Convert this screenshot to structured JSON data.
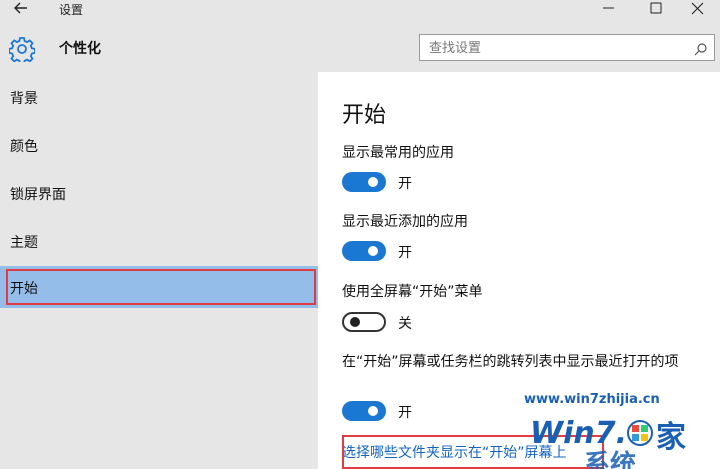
{
  "window": {
    "title": "设置"
  },
  "header": {
    "title": "个性化",
    "search_placeholder": "查找设置"
  },
  "sidebar": {
    "items": [
      {
        "label": "背景"
      },
      {
        "label": "颜色"
      },
      {
        "label": "锁屏界面"
      },
      {
        "label": "主题"
      },
      {
        "label": "开始",
        "active": true
      }
    ]
  },
  "main": {
    "section_title": "开始",
    "settings": [
      {
        "label": "显示最常用的应用",
        "state": "开",
        "on": true
      },
      {
        "label": "显示最近添加的应用",
        "state": "开",
        "on": true
      },
      {
        "label": "使用全屏幕“开始”菜单",
        "state": "关",
        "on": false
      },
      {
        "label": "在“开始”屏幕或任务栏的跳转列表中显示最近打开的项",
        "state": "开",
        "on": true
      }
    ],
    "link": "选择哪些文件夹显示在“开始”屏幕上"
  },
  "watermark": {
    "url": "www.win7zhijia.cn",
    "logo_text": "Win7之家"
  },
  "colors": {
    "accent": "#1a78d2",
    "sidebar_active": "#94bde9",
    "highlight_outline": "#e03c43",
    "chrome": "#e6e6e6"
  }
}
